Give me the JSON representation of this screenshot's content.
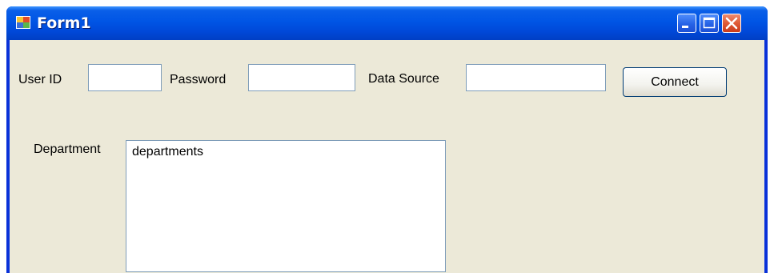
{
  "window": {
    "title": "Form1"
  },
  "form": {
    "user_id_label": "User ID",
    "user_id_value": "",
    "password_label": "Password",
    "password_value": "",
    "data_source_label": "Data Source",
    "data_source_value": "",
    "connect_button_label": "Connect",
    "department_label": "Department",
    "department_list": [
      "departments"
    ]
  },
  "colors": {
    "title_bar": "#0054e3",
    "client_background": "#ece9d8",
    "close_button": "#e0572f",
    "input_border": "#7f9db9"
  },
  "icons": {
    "app": "form-app-icon",
    "minimize": "minimize-icon",
    "maximize": "maximize-icon",
    "close": "close-icon"
  }
}
